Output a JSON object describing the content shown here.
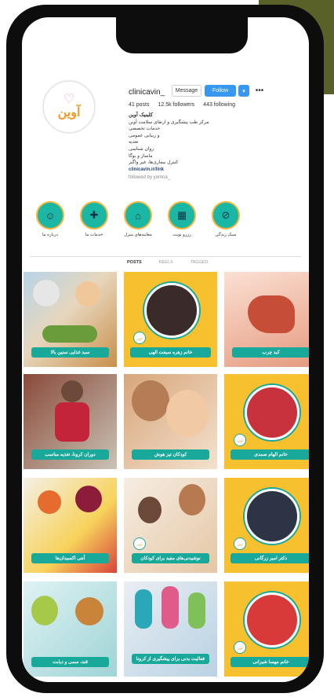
{
  "colors": {
    "accent": "#3897f0",
    "teal": "#19a99a",
    "yellow": "#f6c02e",
    "brand_orange": "#f39a2a"
  },
  "logo": {
    "text": "آوین"
  },
  "profile": {
    "username": "clinicavin_",
    "message_label": "Message",
    "follow_label": "Follow",
    "stats": {
      "posts": "41 posts",
      "followers": "12.5k followers",
      "following": "443 following"
    },
    "bio_name": "کلینیک آوین",
    "bio_lines": [
      "مرکز طب پیشگیری و ارتقای سلامت آوین",
      "خدمات تخصصی",
      "و زیبایی عمومی",
      "تغذیه",
      "روان شناسی",
      "ماساژ و یوگا",
      "کنترل بیماری‌ها، غیر واگیر"
    ],
    "link": "clinicavin.ir/link",
    "followed_by": "followed by yomna_"
  },
  "highlights": [
    {
      "label": "درباره ما",
      "icon": "people-icon"
    },
    {
      "label": "خدمات ما",
      "icon": "medical-hand-icon"
    },
    {
      "label": "معاینه‌های منزل",
      "icon": "home-care-icon"
    },
    {
      "label": "رزرو نوبت",
      "icon": "calendar-icon"
    },
    {
      "label": "سبک زندگی",
      "icon": "no-smoking-icon"
    }
  ],
  "tabs": [
    "POSTS",
    "REELS",
    "TAGGED"
  ],
  "posts": [
    {
      "caption": "سبد غذایی سنین بالا"
    },
    {
      "caption": "خانم زهره سیفت الهی"
    },
    {
      "caption": "کبد چرب"
    },
    {
      "caption": "دوران کرونا، تغذیه مناسب"
    },
    {
      "caption": "کودکان تیز هوش"
    },
    {
      "caption": "خانم الهام صمدی"
    },
    {
      "caption": "آنتی اکسیدان‌ها"
    },
    {
      "caption": "نوشیدنی‌های مفید برای کودکان"
    },
    {
      "caption": "دکتر امیر زرگانی"
    },
    {
      "caption": "قند، سمی و دیابت"
    },
    {
      "caption": "فعالیت بدنی برای پیشگیری از کرونا"
    },
    {
      "caption": "خانم مهسا شیرانی"
    }
  ]
}
